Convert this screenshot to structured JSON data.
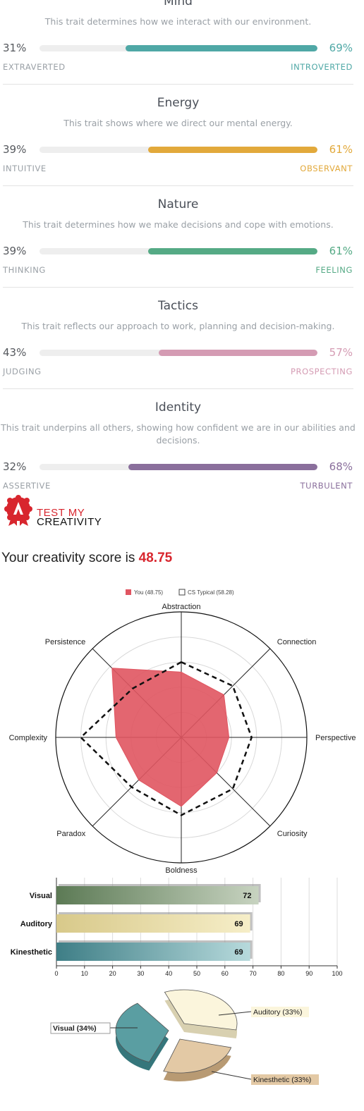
{
  "traits": [
    {
      "title": "Mind",
      "description": "This trait determines how we interact with our environment.",
      "left_pct": "31%",
      "right_pct": "69%",
      "left_label": "EXTRAVERTED",
      "right_label": "INTROVERTED",
      "right_value": 69,
      "color": "#4fa8a6"
    },
    {
      "title": "Energy",
      "description": "This trait shows where we direct our mental energy.",
      "left_pct": "39%",
      "right_pct": "61%",
      "left_label": "INTUITIVE",
      "right_label": "OBSERVANT",
      "right_value": 61,
      "color": "#e2a93b"
    },
    {
      "title": "Nature",
      "description": "This trait determines how we make decisions and cope with emotions.",
      "left_pct": "39%",
      "right_pct": "61%",
      "left_label": "THINKING",
      "right_label": "FEELING",
      "right_value": 61,
      "color": "#55aa85"
    },
    {
      "title": "Tactics",
      "description": "This trait reflects our approach to work, planning and decision-making.",
      "left_pct": "43%",
      "right_pct": "57%",
      "left_label": "JUDGING",
      "right_label": "PROSPECTING",
      "right_value": 57,
      "color": "#d49bb3"
    },
    {
      "title": "Identity",
      "description": "This trait underpins all others, showing how confident we are in our abilities and decisions.",
      "left_pct": "32%",
      "right_pct": "68%",
      "left_label": "ASSERTIVE",
      "right_label": "TURBULENT",
      "right_value": 68,
      "color": "#8a6f9c"
    }
  ],
  "logo": {
    "line1": "TEST MY",
    "line2": "CREATIVITY",
    "brand_color": "#d8262e"
  },
  "score": {
    "prefix": "Your creativity score is ",
    "value": "48.75"
  },
  "chart_data": [
    {
      "type": "radar",
      "legend": [
        {
          "name": "You (48.75)",
          "color": "#e05561"
        },
        {
          "name": "CS Typical (58.28)",
          "color": "#111111"
        }
      ],
      "axes": [
        "Abstraction",
        "Connection",
        "Perspective",
        "Curiosity",
        "Boldness",
        "Paradox",
        "Complexity",
        "Persistence"
      ],
      "max": 100,
      "series": [
        {
          "name": "You (48.75)",
          "values": [
            52,
            48,
            38,
            40,
            55,
            48,
            52,
            78
          ]
        },
        {
          "name": "CS Typical (58.28)",
          "values": [
            60,
            58,
            56,
            58,
            62,
            56,
            80,
            55
          ]
        }
      ]
    },
    {
      "type": "bar",
      "orientation": "horizontal",
      "categories": [
        "Visual",
        "Auditory",
        "Kinesthetic"
      ],
      "values": [
        72,
        69,
        69
      ],
      "value_labels": [
        "72",
        "69",
        "69"
      ],
      "xlim": [
        0,
        100
      ],
      "xticks": [
        "0",
        "10",
        "20",
        "30",
        "40",
        "50",
        "60",
        "70",
        "80",
        "90",
        "100"
      ],
      "colors": [
        "#7a9a72",
        "#e7dca4",
        "#5e9ea2"
      ]
    },
    {
      "type": "pie",
      "labels": [
        "Visual (34%)",
        "Auditory (33%)",
        "Kinesthetic (33%)"
      ],
      "values": [
        34,
        33,
        33
      ],
      "colors": [
        "#5a9ea2",
        "#fbf5dc",
        "#e3c9a5"
      ]
    }
  ]
}
